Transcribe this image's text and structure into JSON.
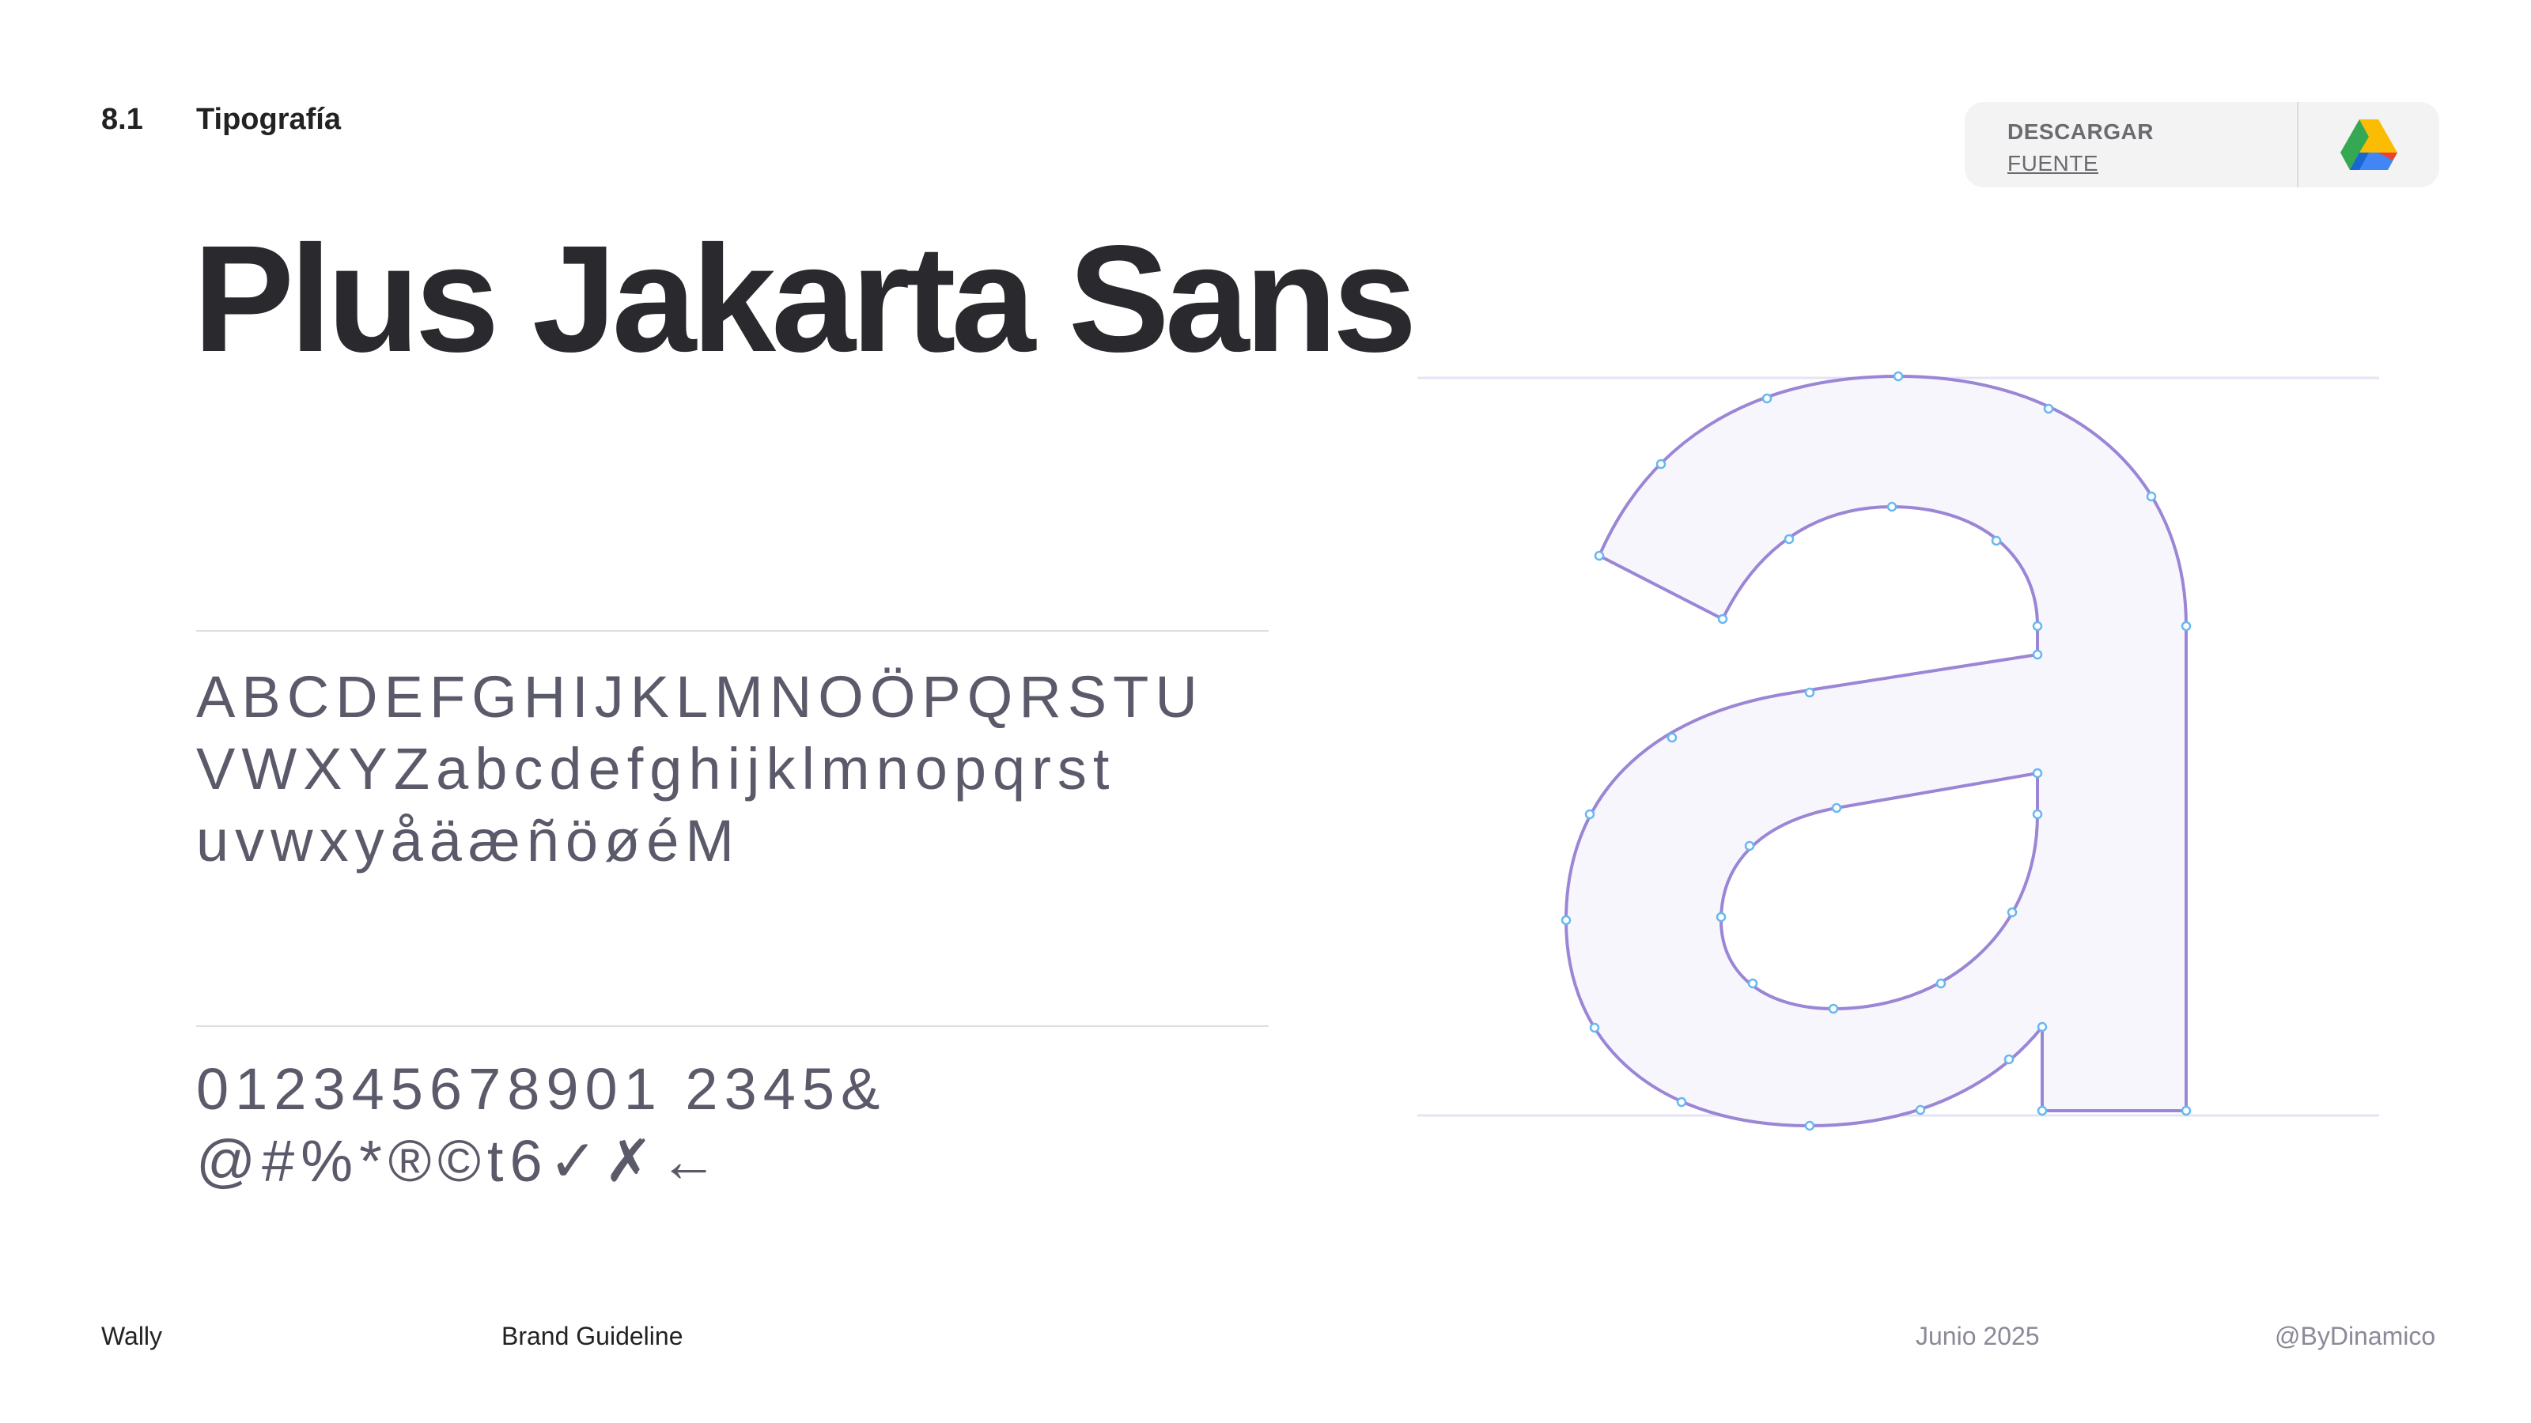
{
  "header": {
    "section_number": "8.1",
    "section_title": "Tipografía"
  },
  "download": {
    "line1": "DESCARGAR",
    "line2": "FUENTE",
    "icon": "google-drive-icon"
  },
  "font_name": "Plus Jakarta Sans",
  "alphabet": {
    "line1": "ABCDEFGHIJKLMNOÖPQRSTU",
    "line2": "VWXYZabcdefghijklmnopqrst",
    "line3": "uvwxyåäæñöøéM"
  },
  "numerals": {
    "line1": "012345678901 2345&",
    "line2": "@#%*®©t6✓✗←"
  },
  "specimen_letter": "a",
  "footer": {
    "brand": "Wally",
    "doc": "Brand Guideline",
    "date": "Junio 2025",
    "handle": "@ByDinamico"
  },
  "colors": {
    "outline": "#9b86d6",
    "fill": "#f8f6fd",
    "anchor": "#66b8ee",
    "guideline": "#e4e4f4",
    "glyph_text": "#5a5a6a"
  }
}
